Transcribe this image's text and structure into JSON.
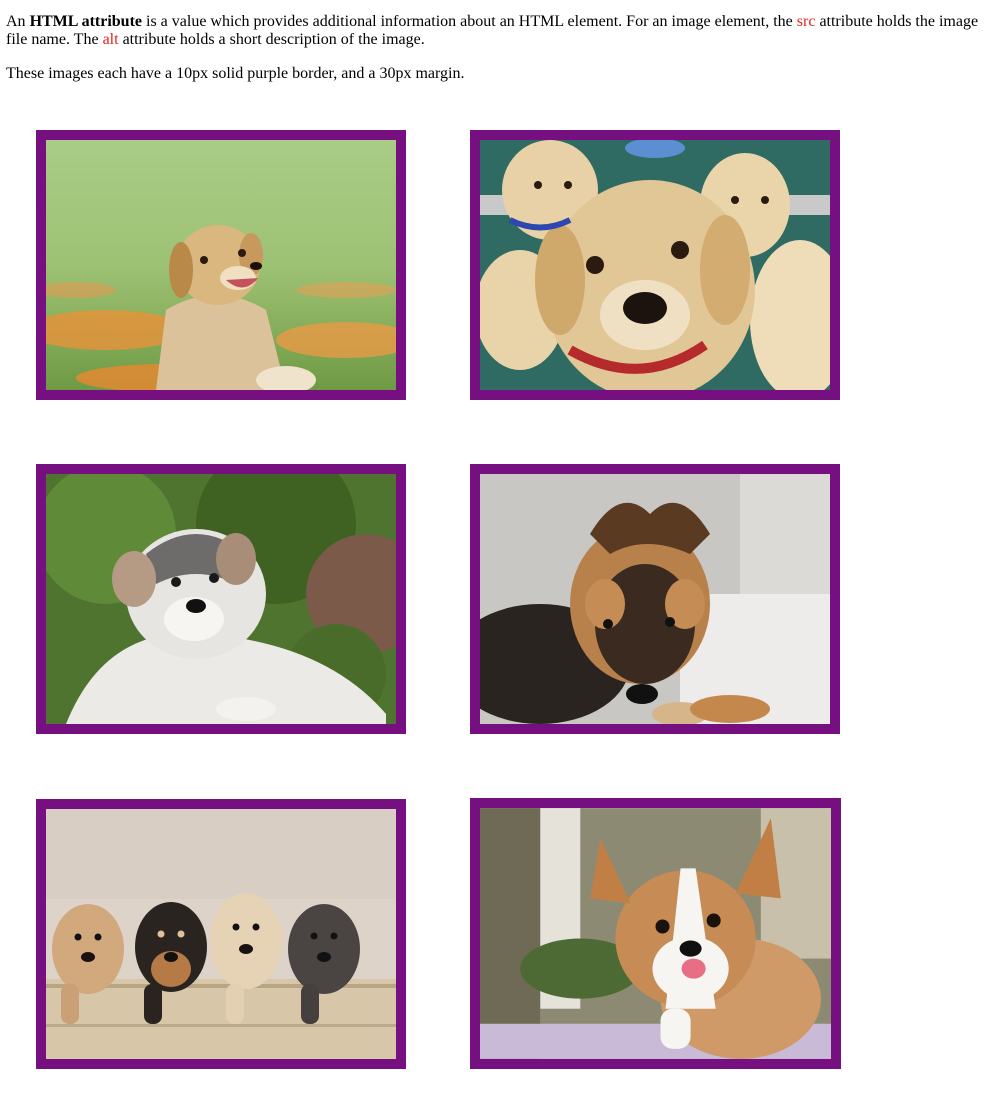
{
  "intro": {
    "part1": "An ",
    "bold": "HTML attribute",
    "part2": " is a value which provides additional information about an HTML element. For an image element, the ",
    "src_word": "src",
    "part3": " attribute holds the image file name. The ",
    "alt_word": "alt",
    "part4": " attribute holds a short description of the image."
  },
  "note": "These images each have a 10px solid purple border, and a 30px margin.",
  "colors": {
    "border": "#760f80",
    "attribute_highlight": "#e8231c"
  },
  "images": [
    {
      "subject": "golden puppy sitting in grass with orange flowers"
    },
    {
      "subject": "group of yellow labrador puppies"
    },
    {
      "subject": "fluffy malamute puppy lying by a bush"
    },
    {
      "subject": "german shepherd puppy chewing a toy"
    },
    {
      "subject": "four puppies peeking over a wooden box"
    },
    {
      "subject": "corgi puppy with tongue out"
    }
  ]
}
